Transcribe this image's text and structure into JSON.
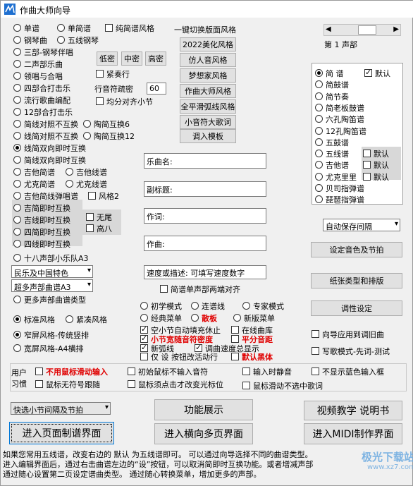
{
  "window": {
    "title": "作曲大师向导"
  },
  "left_options": {
    "r1": [
      "单谱",
      "单简谱"
    ],
    "chk_pure": "纯简谱风格",
    "r2": [
      "钢琴曲",
      "五线钢琴"
    ],
    "r3": "三部-钢琴伴唱",
    "r4": "二声部乐曲",
    "r5": "领唱与合唱",
    "r6": "四部合打击乐",
    "r7": "流行歌曲编配",
    "r8": "12部合打击乐",
    "r9": [
      "简线对照不互换",
      "陶简互换6"
    ],
    "r10": [
      "线简对照不互换",
      "陶简互换12"
    ],
    "r11": "线简双向即时互换",
    "r12": "简线双向即时互换",
    "r13": [
      "吉他简谱",
      "吉他线谱"
    ],
    "r14": [
      "尤克简谱",
      "尤克线谱"
    ],
    "r15": "吉他简线弹唱谱",
    "chk_style2": "风格2",
    "r16": "吉简即时互换",
    "r17": "吉线即时互换",
    "chk_noend": "无尾",
    "r18": "四简即时互换",
    "chk_highb": "高八",
    "r19": "四线即时互换",
    "r20": "十八声部小乐队A3",
    "combo1": "民乐及中国特色",
    "combo2": "超多声部曲谱A3",
    "r21": "更多声部曲谱类型"
  },
  "density": {
    "low": "低密",
    "mid": "中密",
    "high": "高密",
    "tight_label": "紧奏行",
    "row_label": "行音符疏密",
    "row_value": "60",
    "chk_even": "均分对齐小节"
  },
  "style_buttons": {
    "header": "一键切换版面风格",
    "b1": "2022美化风格",
    "b2": "仿人音风格",
    "b3": "梦想家风格",
    "b4": "作曲大师风格",
    "b5": "全平滑弧线风格",
    "b6": "小音符大歌词",
    "b7": "调入模板"
  },
  "fields": {
    "title": "乐曲名:",
    "subtitle": "副标题:",
    "lyricist": "作词:",
    "composer": "作曲:",
    "speed": "速度或描述: 可填写速度数字"
  },
  "chk_single_voice": "简谱单声部两端对齐",
  "voice_scroll": {
    "label": "第 1 声部"
  },
  "notation_list": {
    "items": [
      "简 谱",
      "简鼓谱",
      "简节奏",
      "简老板鼓谱",
      "六孔陶笛谱",
      "12孔陶笛谱",
      "五鼓谱",
      "五线谱",
      "吉他谱",
      "尤克里里",
      "贝司指弹谱",
      "琵琶指弹谱"
    ],
    "default_label": "默认"
  },
  "autosave_combo": "自动保存间隔",
  "right_buttons": {
    "timbre": "设定音色及节拍",
    "paper": "纸张类型和排版",
    "tune": "调性设定"
  },
  "modes": {
    "standard": "标准风格",
    "tight": "紧凑风格",
    "narrow": "窄屏风格-传统竖排",
    "wide": "宽屏风格-A4横排",
    "beginner": "初学模式",
    "connect": "连谱线",
    "expert": "专家模式",
    "classic_menu": "经典菜单",
    "drum": "散板",
    "new_menu": "新版菜单",
    "chk_autofill": "空小节自动填充休止",
    "chk_online": "在线曲库",
    "chk_width": "小节宽随音符密度",
    "chk_flat": "平分音距",
    "chk_arc": "新弧线",
    "chk_speed": "调曲速度总显示",
    "chk_only": "仅 设 按钮改活动行",
    "chk_bold": "默认黑体",
    "chk_apply": "向导应用到调旧曲",
    "chk_write": "写歌模式-先词-测试"
  },
  "habits": {
    "label1": "用户",
    "label2": "习惯",
    "c1": "不用鼠标滑动输入",
    "c2": "初始鼠标不输入音符",
    "c3": "输入时静音",
    "c4": "不显示蓝色输入框",
    "c5": "鼠标无符号跟随",
    "c6": "鼠标须点击才改变光标位",
    "c7": "鼠标滑动不选中歌词"
  },
  "bottom": {
    "combo": "快选小节间隔及节拍",
    "demo": "功能展示",
    "video": "视频教学 说明书",
    "enter_page": "进入页面制谱界面",
    "enter_horizontal": "进入横向多页界面",
    "enter_midi": "进入MIDI制作界面"
  },
  "footer": {
    "line1": "如果您常用五线谱，改变右边的 默认 为五线谱即可。        可以通过向导选择不同的曲谱类型。",
    "line2": "进入编辑界面后，通过右击曲谱左边的“设”按钮，可以取消简即时互换功能。或者增减声部",
    "line3": "通过随心设置第二页设定谱曲类型。        通过随心转换菜单，增加更多的声部。",
    "watermark": "极光下载站",
    "watermark2": "www.xz7.com"
  }
}
